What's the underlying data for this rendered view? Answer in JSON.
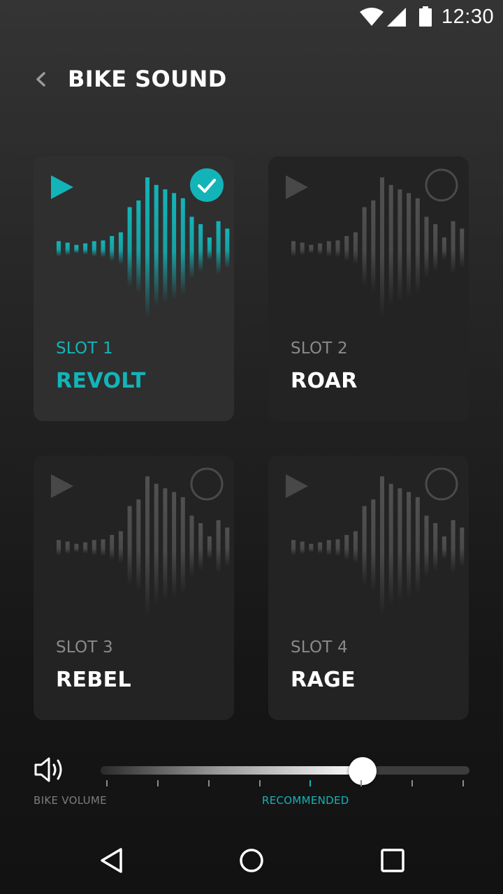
{
  "status_bar": {
    "time": "12:30",
    "icons": [
      "wifi-icon",
      "signal-icon",
      "battery-icon"
    ]
  },
  "header": {
    "back_icon": "chevron-left-icon",
    "title": "BIKE SOUND"
  },
  "sound_slots": [
    {
      "slot": "SLOT 1",
      "name": "REVOLT",
      "selected": true
    },
    {
      "slot": "SLOT 2",
      "name": "ROAR",
      "selected": false
    },
    {
      "slot": "SLOT 3",
      "name": "REBEL",
      "selected": false
    },
    {
      "slot": "SLOT 4",
      "name": "RAGE",
      "selected": false
    }
  ],
  "volume": {
    "label": "BIKE VOLUME",
    "recommended_label": "RECOMMENDED",
    "level_fraction": 0.71,
    "recommended_fraction": 0.57,
    "tick_count": 8
  },
  "nav_bar": {
    "icons": [
      "back-triangle-icon",
      "home-circle-icon",
      "recents-square-icon"
    ]
  },
  "colors": {
    "accent": "#13b4b8",
    "card_selected": "#2f2f2f",
    "card": "#232323",
    "muted_text": "#8a8a8a"
  }
}
